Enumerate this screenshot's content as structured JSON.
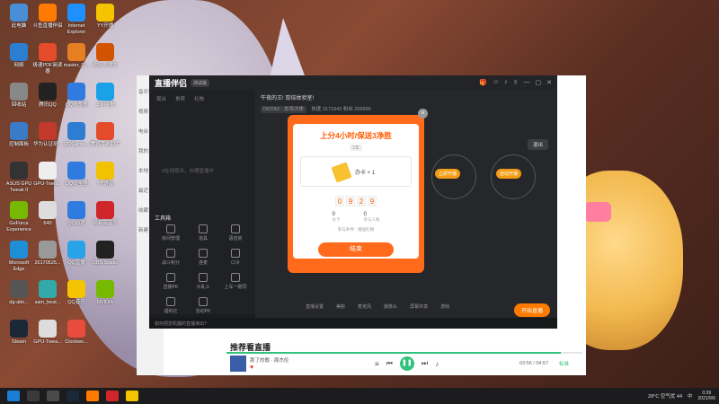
{
  "desktop_icons": [
    {
      "label": "此电脑",
      "color": "#4a8fd6"
    },
    {
      "label": "斗鱼直播伴侣",
      "color": "#ff7a00"
    },
    {
      "label": "Internet Explorer",
      "color": "#1e90ff"
    },
    {
      "label": "YY开播",
      "color": "#f5c400"
    },
    {
      "label": "网络",
      "color": "#2a7fd0"
    },
    {
      "label": "极速PDF阅读器",
      "color": "#e34b2a"
    },
    {
      "label": "master_O...",
      "color": "#e67e22"
    },
    {
      "label": "欢乐斗地主",
      "color": "#d35400"
    },
    {
      "label": "回收站",
      "color": "#888"
    },
    {
      "label": "腾讯QQ",
      "color": "#222"
    },
    {
      "label": "QQ浏览器",
      "color": "#2f7be0"
    },
    {
      "label": "上网导航",
      "color": "#1aa1e8"
    },
    {
      "label": "控制面板",
      "color": "#3a7bc8"
    },
    {
      "label": "华为认证培...",
      "color": "#c0392b"
    },
    {
      "label": "QQGame...",
      "color": "#2d7dd2"
    },
    {
      "label": "腾讯手游助手",
      "color": "#e34b2a"
    },
    {
      "label": "ASUS GPU Tweak II",
      "color": "#333"
    },
    {
      "label": "GPU-Twea...",
      "color": "#eee"
    },
    {
      "label": "QQ安全器",
      "color": "#2f7be0"
    },
    {
      "label": "YY语音",
      "color": "#f2c200"
    },
    {
      "label": "GeForce Experience",
      "color": "#76b900"
    },
    {
      "label": "640",
      "color": "#ddd"
    },
    {
      "label": "QQ游戏",
      "color": "#2f7be0"
    },
    {
      "label": "网易云音乐",
      "color": "#d0262b"
    },
    {
      "label": "Microsoft Edge",
      "color": "#1e8fd6"
    },
    {
      "label": "20170525...",
      "color": "#999"
    },
    {
      "label": "QQ直播",
      "color": "#29a3e8"
    },
    {
      "label": "OBS Studio",
      "color": "#222"
    },
    {
      "label": "dg-alto...",
      "color": "#555"
    },
    {
      "label": "sam_beat...",
      "color": "#3aa"
    },
    {
      "label": "QQ音乐",
      "color": "#f4c400"
    },
    {
      "label": "NVIDIA",
      "color": "#76b900"
    },
    {
      "label": "Steam",
      "color": "#1b2838"
    },
    {
      "label": "GPU-Twea...",
      "color": "#ddd"
    },
    {
      "label": "Clockwo...",
      "color": "#e74c3c"
    }
  ],
  "music_app": {
    "side_items": [
      "音乐馆",
      "视频",
      "电台",
      "我的",
      "本地",
      "最近",
      "收藏",
      "新建"
    ],
    "recommend_title": "推荐看直播",
    "song_title": "那了的歌 - 周杰伦",
    "time": "03:56 / 04:57",
    "quality": "标准"
  },
  "stream_app": {
    "logo": "直播伴侣",
    "beta": "测试版",
    "left_tabs": [
      "观众",
      "贵宾",
      "礼物"
    ],
    "left_hint": "0在线观众，办理直播中",
    "tools_header": "工具箱",
    "tools": [
      "房间管理",
      "道具",
      "语音房",
      "战斗积分",
      "连麦",
      "口令",
      "直播PK",
      "大乱斗",
      "上车一键同",
      "福利社",
      "活动PK"
    ],
    "status_text": "如何把您机器的直播演出?",
    "room_title": "午夜的王! 双倍体验室!",
    "room_game": "DOTA2 · 本场次体",
    "room_hot": "热度 3171942",
    "room_fans": "粉丝 265990",
    "exit": "退出",
    "step_btns": [
      "立即开播",
      "自动开播"
    ],
    "start_button": "开始直播",
    "bottom_tools": [
      "直播设置",
      "美颜",
      "麦克风",
      "摄像头",
      "屏幕共享",
      "游戏"
    ]
  },
  "modal": {
    "title": "上分4小时/保送3净胜",
    "sub": "1年",
    "reward_label": "办卡 × 1",
    "timer_digits": [
      "0",
      "9",
      "2",
      "9"
    ],
    "stat1_value": "0",
    "stat1_label": "办卡",
    "stat2_value": "0",
    "stat2_label": "参与人数",
    "hint": "参与条件：赠送礼物",
    "confirm": "结束"
  },
  "taskbar": {
    "weather": "28°C 空气优 44",
    "time": "0:39",
    "date": "2021/9/6",
    "lang": "中"
  }
}
